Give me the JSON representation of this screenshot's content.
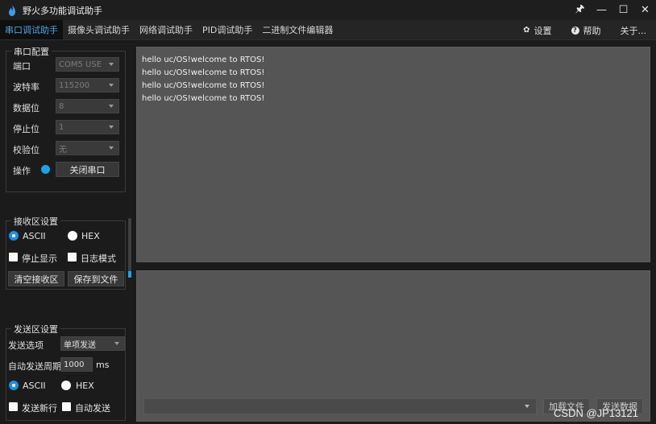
{
  "window": {
    "title": "野火多功能调试助手",
    "pin_glyph": "🖈",
    "min_glyph": "—",
    "max_glyph": "☐",
    "close_glyph": "✕"
  },
  "tabs": [
    {
      "label": "串口调试助手",
      "active": true
    },
    {
      "label": "摄像头调试助手"
    },
    {
      "label": "网络调试助手"
    },
    {
      "label": "PID调试助手"
    },
    {
      "label": "二进制文件编辑器"
    }
  ],
  "right_tabs": {
    "settings": "设置",
    "help": "帮助",
    "about": "关于..."
  },
  "serial_config": {
    "title": "串口配置",
    "port_label": "端口",
    "port_value": "COM5 USE",
    "baud_label": "波特率",
    "baud_value": "115200",
    "data_label": "数据位",
    "data_value": "8",
    "stop_label": "停止位",
    "stop_value": "1",
    "parity_label": "校验位",
    "parity_value": "无",
    "op_label": "操作",
    "close_button": "关闭串口"
  },
  "recv_settings": {
    "title": "接收区设置",
    "ascii": "ASCII",
    "hex": "HEX",
    "stop_display": "停止显示",
    "log_mode": "日志模式",
    "clear": "清空接收区",
    "save": "保存到文件"
  },
  "send_settings": {
    "title": "发送区设置",
    "option_label": "发送选项",
    "option_value": "单项发送",
    "period_label": "自动发送周期",
    "period_value": "1000",
    "period_unit": "ms",
    "ascii": "ASCII",
    "hex": "HEX",
    "newline": "发送新行",
    "auto_send": "自动发送"
  },
  "receive_lines": [
    "hello uc/OS!welcome to RTOS!",
    "hello uc/OS!welcome to RTOS!",
    "hello uc/OS!welcome to RTOS!",
    "hello uc/OS!welcome to RTOS!"
  ],
  "send_panel": {
    "load_file": "加载文件",
    "send_data": "发送数据"
  },
  "watermark": "CSDN @JP13121",
  "colors": {
    "accent": "#1fa1e6",
    "active_tab_text": "#4ea3e6"
  }
}
